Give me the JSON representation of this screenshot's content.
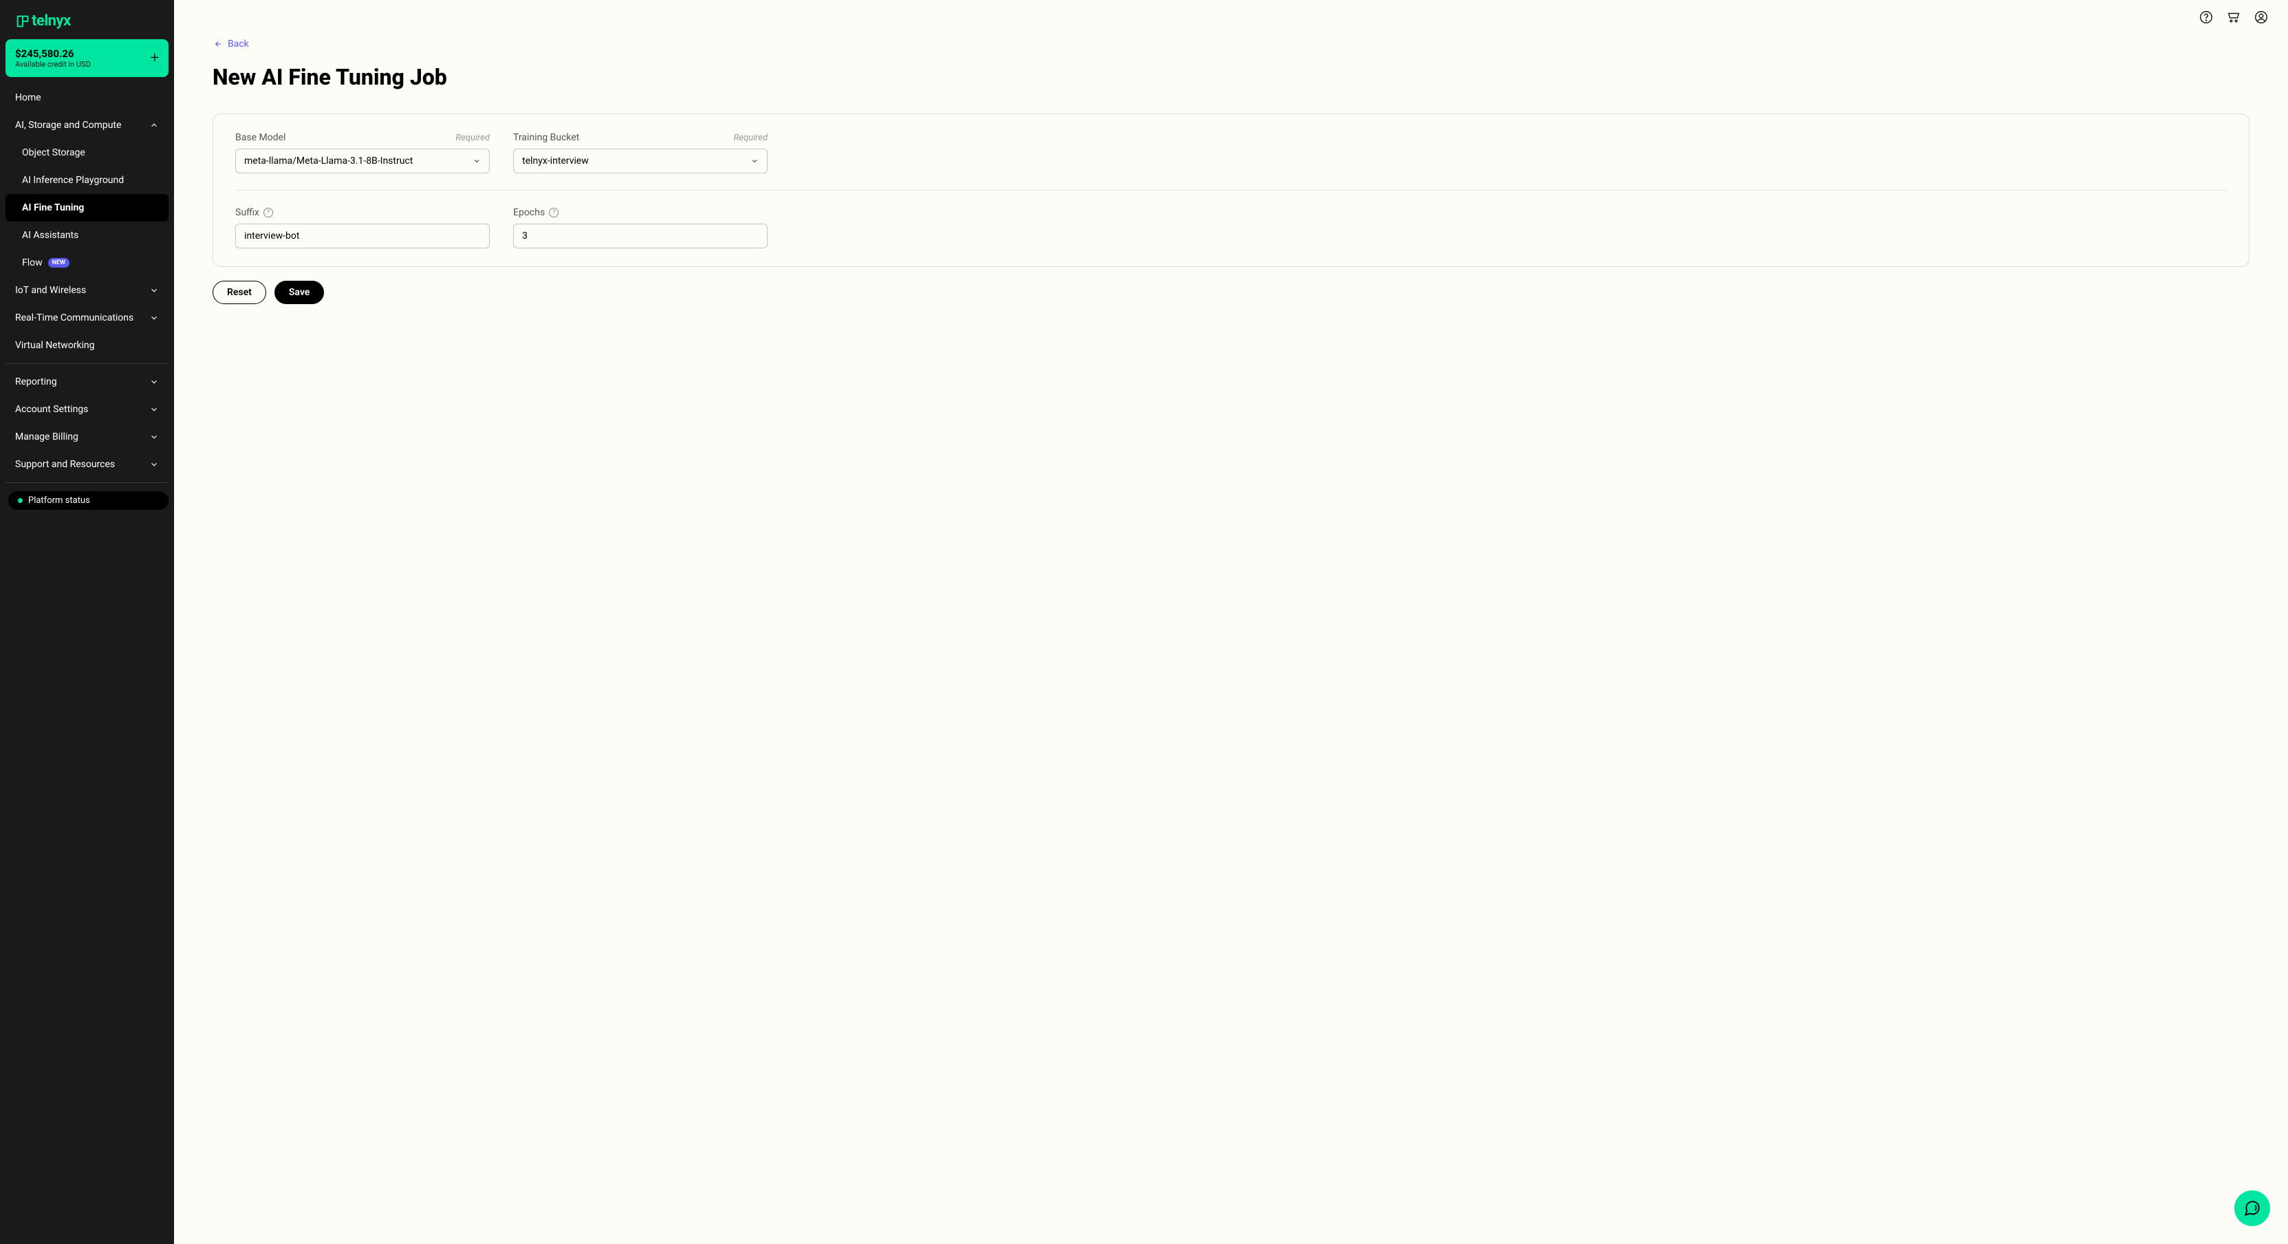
{
  "brand": "telnyx",
  "credit": {
    "amount": "$245,580.26",
    "label": "Available credit in USD"
  },
  "nav": {
    "home": "Home",
    "ai_section": "AI, Storage and Compute",
    "object_storage": "Object Storage",
    "ai_inference": "AI Inference Playground",
    "ai_fine_tuning": "AI Fine Tuning",
    "ai_assistants": "AI Assistants",
    "flow": "Flow",
    "flow_badge": "NEW",
    "iot": "IoT and Wireless",
    "rtc": "Real-Time Communications",
    "vn": "Virtual Networking",
    "reporting": "Reporting",
    "account": "Account Settings",
    "billing": "Manage Billing",
    "support": "Support and Resources",
    "status": "Platform status"
  },
  "page": {
    "back": "Back",
    "title": "New AI Fine Tuning Job"
  },
  "form": {
    "base_model_label": "Base Model",
    "required": "Required",
    "base_model_value": "meta-llama/Meta-Llama-3.1-8B-Instruct",
    "training_bucket_label": "Training Bucket",
    "training_bucket_value": "telnyx-interview",
    "suffix_label": "Suffix",
    "suffix_value": "interview-bot",
    "epochs_label": "Epochs",
    "epochs_value": "3"
  },
  "buttons": {
    "reset": "Reset",
    "save": "Save"
  }
}
